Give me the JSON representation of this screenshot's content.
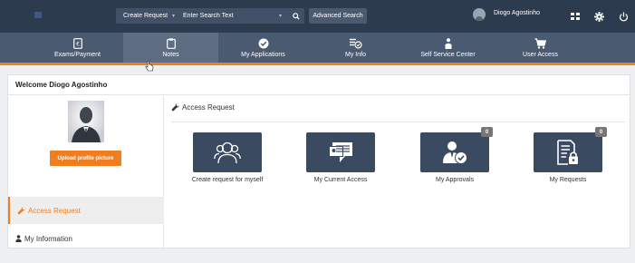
{
  "topbar": {
    "search_scope": "Create Request",
    "search_placeholder": "Enter Search Text",
    "advanced_search": "Advanced Search",
    "user_name": "Diogo Agostinho"
  },
  "nav": {
    "items": [
      {
        "label": "Exams/Payment",
        "icon": "euro-document-icon"
      },
      {
        "label": "Notes",
        "icon": "clipboard-icon"
      },
      {
        "label": "My Applications",
        "icon": "check-circle-icon"
      },
      {
        "label": "My Info",
        "icon": "info-list-icon"
      },
      {
        "label": "Self Service Center",
        "icon": "person-icon"
      },
      {
        "label": "User Access",
        "icon": "cart-icon"
      }
    ]
  },
  "page": {
    "welcome": "Welcome Diogo Agostinho",
    "upload_button": "Upload profile picture"
  },
  "sidebar": {
    "items": [
      {
        "label": "Access Request"
      },
      {
        "label": "My Information"
      }
    ]
  },
  "main": {
    "section_title": "Access Request",
    "tiles": [
      {
        "label": "Create request for myself",
        "icon": "users-icon"
      },
      {
        "label": "My Current Access",
        "icon": "id-card-icon"
      },
      {
        "label": "My Approvals",
        "icon": "user-check-icon",
        "badge": "0"
      },
      {
        "label": "My Requests",
        "icon": "lock-document-icon",
        "badge": "0"
      }
    ]
  },
  "colors": {
    "topbar": "#2d3b4f",
    "navbar": "#4a5a70",
    "accent": "#f07d1e",
    "tile": "#3a4a60"
  }
}
